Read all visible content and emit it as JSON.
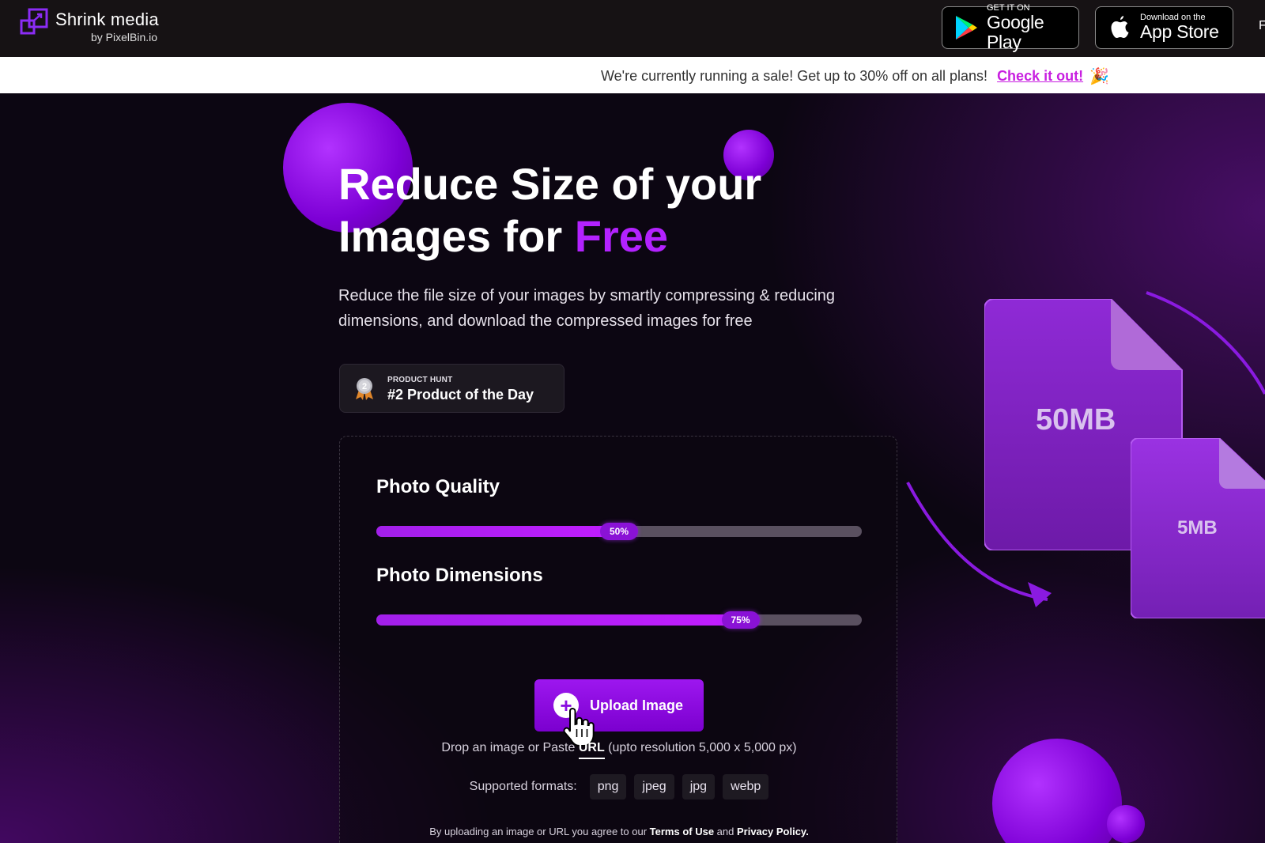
{
  "header": {
    "logo_name": "Shrink media",
    "logo_by": "by PixelBin.io",
    "google_play": {
      "small": "GET IT ON",
      "big": "Google Play"
    },
    "app_store": {
      "small": "Download on the",
      "big": "App Store"
    },
    "edge_char": "F"
  },
  "banner": {
    "text": "We're currently running a sale! Get up to 30% off on all plans!",
    "link": "Check it out!",
    "emoji": "🎉"
  },
  "hero": {
    "title_line1": "Reduce Size of your",
    "title_line2": "Images for ",
    "title_accent": "Free",
    "subtitle": "Reduce the file size of your images by smartly compressing & reducing dimensions, and download the compressed images for free",
    "product_hunt": {
      "small": "PRODUCT HUNT",
      "big": "#2 Product of the Day",
      "medal_number": "2"
    }
  },
  "panel": {
    "quality_label": "Photo Quality",
    "quality_value": 50,
    "quality_text": "50%",
    "dimensions_label": "Photo Dimensions",
    "dimensions_value": 75,
    "dimensions_text": "75%",
    "upload_label": "Upload Image",
    "drop_prefix": "Drop an image or Paste ",
    "drop_url": "URL",
    "drop_suffix": " (upto resolution 5,000 x 5,000 px)",
    "formats_label": "Supported formats:",
    "formats": [
      "png",
      "jpeg",
      "jpg",
      "webp"
    ],
    "terms_prefix": "By uploading an image or URL you agree to our ",
    "terms_link": "Terms of Use",
    "terms_mid": " and ",
    "privacy_link": "Privacy Policy."
  },
  "illustration": {
    "big_size": "50MB",
    "small_size": "5MB"
  },
  "colors": {
    "accent": "#b322ff",
    "banner_link": "#c81ee0",
    "button": "#8a10e0"
  }
}
